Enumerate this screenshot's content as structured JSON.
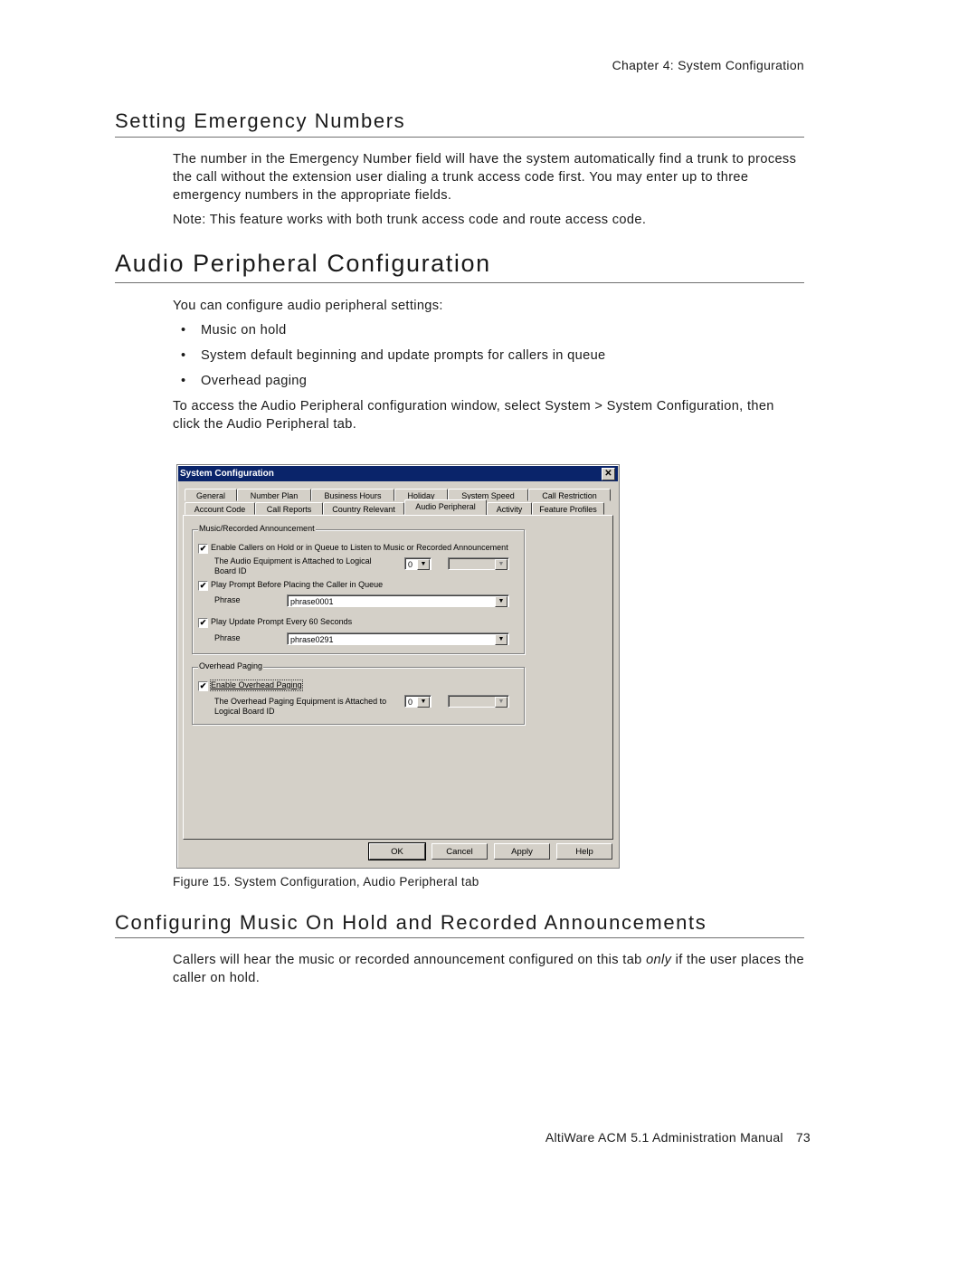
{
  "header": {
    "running_head": "Chapter 4:  System Configuration"
  },
  "section_emergency": {
    "title": "Setting Emergency Numbers",
    "body": "The number in the Emergency Number field will have the system automatically find a trunk to process the call without the extension user dialing a trunk access code first. You may enter up to three emergency numbers in the appropriate fields.",
    "note": "Note:   This feature works with both trunk access code and route access code."
  },
  "section_audio": {
    "title": "Audio Peripheral Configuration",
    "intro": "You can configure audio peripheral settings:",
    "bullets": [
      "Music on hold",
      "System default beginning and update prompts for callers in queue",
      "Overhead paging"
    ],
    "access": "To access the Audio Peripheral configuration window, select System > System Configuration, then click the Audio Peripheral tab."
  },
  "dialog": {
    "title": "System Configuration",
    "close_glyph": "✕",
    "tabs_row1": [
      "General",
      "Number Plan",
      "Business Hours",
      "Holiday",
      "System Speed",
      "Call Restriction"
    ],
    "tabs_row2": [
      "Account Code",
      "Call Reports",
      "Country Relevant",
      "Audio Peripheral",
      "Activity",
      "Feature Profiles"
    ],
    "active_tab": "Audio Peripheral",
    "music_group": {
      "label": "Music/Recorded Announcement",
      "enable_label": "Enable Callers on Hold or in Queue to Listen to Music or Recorded Announcement",
      "enable_checked": true,
      "board_label_1": "The Audio Equipment is Attached to Logical",
      "board_label_2": "Board ID",
      "board_value": "0",
      "board_secondary_value": "",
      "prompt_before_label": "Play Prompt Before Placing the Caller in Queue",
      "prompt_before_checked": true,
      "phrase_label_1": "Phrase",
      "phrase_value_1": "phrase0001",
      "update_prompt_label": "Play Update Prompt Every 60 Seconds",
      "update_prompt_checked": true,
      "phrase_label_2": "Phrase",
      "phrase_value_2": "phrase0291"
    },
    "paging_group": {
      "label": "Overhead Paging",
      "enable_label": "Enable Overhead Paging",
      "enable_checked": true,
      "board_label_1": "The Overhead Paging Equipment is Attached to",
      "board_label_2": "Logical Board ID",
      "board_value": "0",
      "board_secondary_value": ""
    },
    "check_glyph": "✔",
    "arrow_glyph": "▼",
    "buttons": {
      "ok": "OK",
      "cancel": "Cancel",
      "apply": "Apply",
      "help": "Help"
    }
  },
  "figure": {
    "caption": "Figure 15.   System Configuration, Audio Peripheral tab"
  },
  "section_music": {
    "title": "Configuring Music On Hold and Recorded Announcements",
    "body_before": "Callers will hear the music or recorded announcement configured on this tab ",
    "body_emphasis": "only",
    "body_after": " if the user places the caller on hold."
  },
  "footer": {
    "manual": "AltiWare ACM 5.1 Administration Manual",
    "page": "73"
  }
}
